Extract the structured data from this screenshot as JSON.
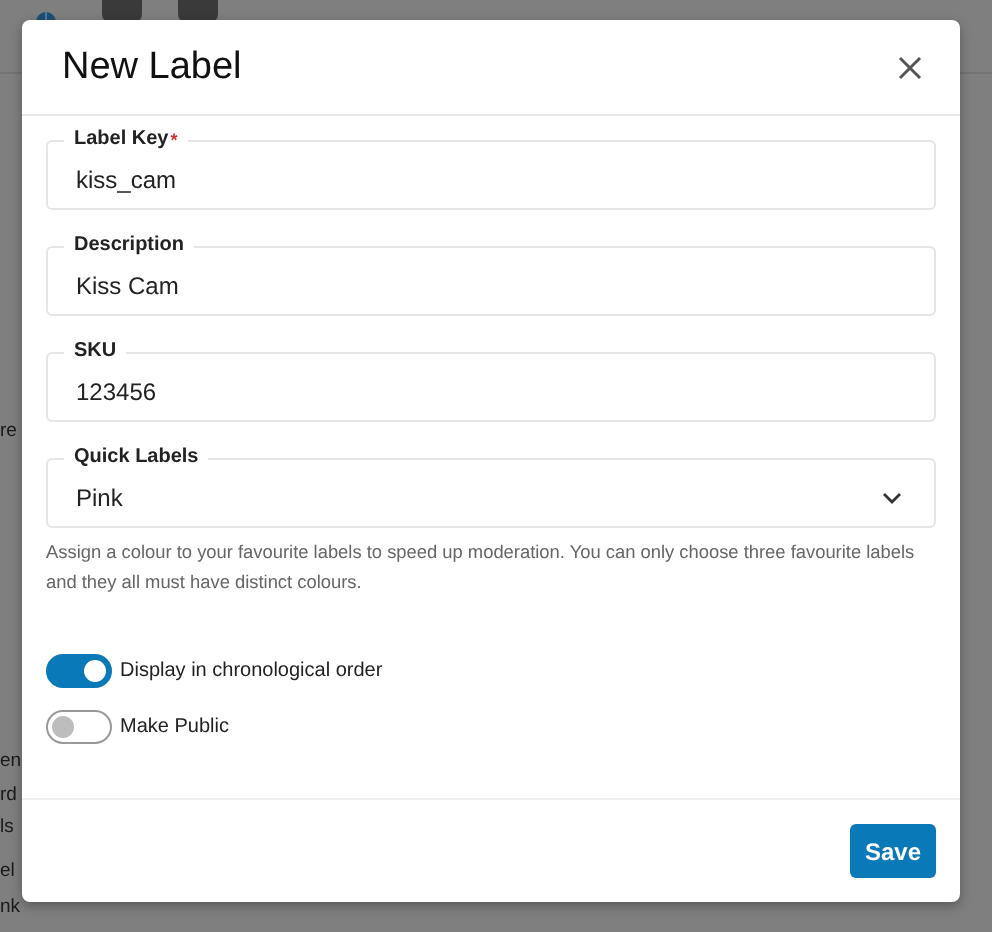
{
  "background": {
    "fragments": [
      "re",
      "en",
      "rd",
      "ls",
      "el",
      "nk"
    ]
  },
  "dialog": {
    "title": "New Label",
    "fields": [
      {
        "kind": "text",
        "label": "Label Key",
        "required_mark": "*",
        "value": "kiss_cam"
      },
      {
        "kind": "text",
        "label": "Description",
        "value": "Kiss Cam"
      },
      {
        "kind": "text",
        "label": "SKU",
        "value": "123456"
      },
      {
        "kind": "select",
        "label": "Quick Labels",
        "value": "Pink"
      }
    ],
    "help": "Assign a colour to your favourite labels to speed up moderation. You can only choose three favourite labels and they all must have distinct colours.",
    "toggles": [
      {
        "label": "Display in chronological order",
        "on": true
      },
      {
        "label": "Make Public",
        "on": false
      }
    ],
    "buttons": [
      "Save"
    ]
  }
}
